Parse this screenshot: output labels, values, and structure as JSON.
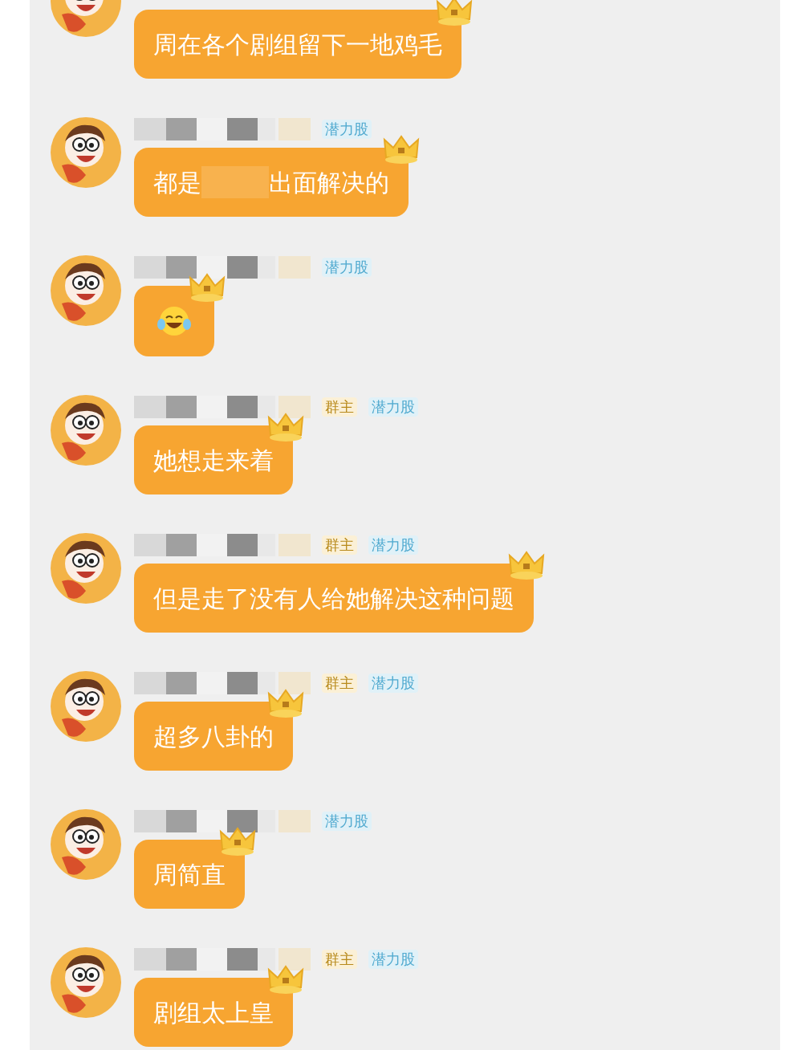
{
  "messages": [
    {
      "name_redacted": false,
      "parts": [
        {
          "kind": "text",
          "text": "周在各个剧组留下一地鸡毛"
        }
      ]
    },
    {
      "name_redacted": true,
      "tags": [
        {
          "kind": "level",
          "label": "潜力股"
        }
      ],
      "parts": [
        {
          "kind": "text",
          "text": "都是"
        },
        {
          "kind": "redacted"
        },
        {
          "kind": "text",
          "text": "出面解决的"
        }
      ]
    },
    {
      "name_redacted": true,
      "tags": [
        {
          "kind": "level",
          "label": "潜力股"
        }
      ],
      "parts": [
        {
          "kind": "emoji"
        }
      ]
    },
    {
      "name_redacted": true,
      "tags": [
        {
          "kind": "owner",
          "label": "群主"
        },
        {
          "kind": "level",
          "label": "潜力股"
        }
      ],
      "parts": [
        {
          "kind": "text",
          "text": "她想走来着"
        }
      ]
    },
    {
      "name_redacted": true,
      "tags": [
        {
          "kind": "owner",
          "label": "群主"
        },
        {
          "kind": "level",
          "label": "潜力股"
        }
      ],
      "parts": [
        {
          "kind": "text",
          "text": "但是走了没有人给她解决这种问题"
        }
      ]
    },
    {
      "name_redacted": true,
      "tags": [
        {
          "kind": "owner",
          "label": "群主"
        },
        {
          "kind": "level",
          "label": "潜力股"
        }
      ],
      "parts": [
        {
          "kind": "text",
          "text": "超多八卦的"
        }
      ]
    },
    {
      "name_redacted": true,
      "tags": [
        {
          "kind": "level",
          "label": "潜力股"
        }
      ],
      "parts": [
        {
          "kind": "text",
          "text": "周简直"
        }
      ]
    },
    {
      "name_redacted": true,
      "tags": [
        {
          "kind": "owner",
          "label": "群主"
        },
        {
          "kind": "level",
          "label": "潜力股"
        }
      ],
      "parts": [
        {
          "kind": "text",
          "text": "剧组太上皇"
        }
      ]
    }
  ]
}
